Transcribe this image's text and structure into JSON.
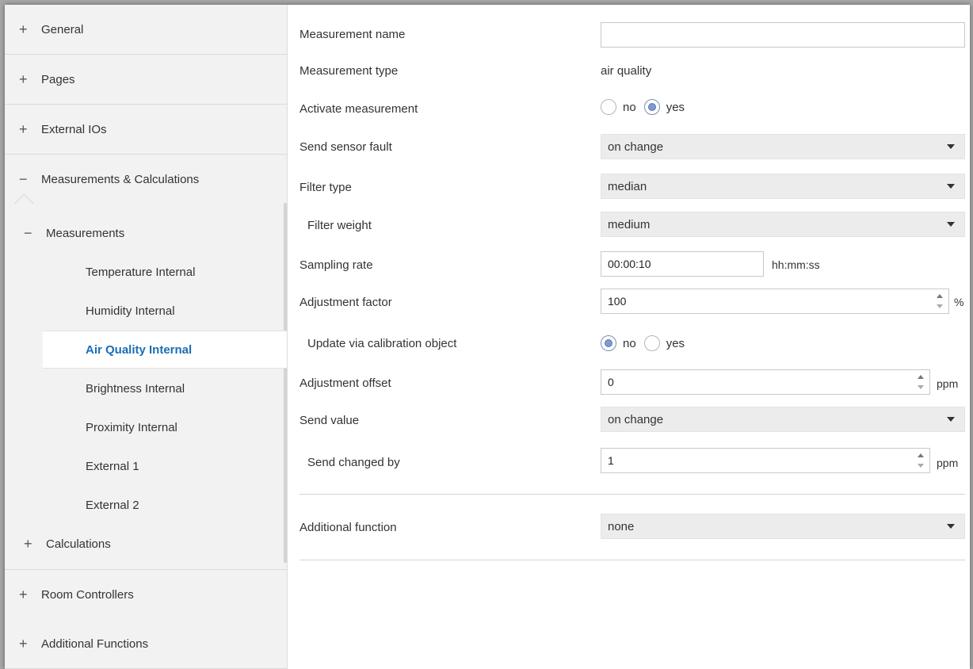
{
  "sidebar": {
    "top_items": [
      {
        "sign": "+",
        "label": "General"
      },
      {
        "sign": "+",
        "label": "Pages"
      },
      {
        "sign": "+",
        "label": "External IOs"
      },
      {
        "sign": "−",
        "label": "Measurements & Calculations"
      }
    ],
    "measurements": {
      "sign": "−",
      "label": "Measurements"
    },
    "measurement_items": [
      "Temperature Internal",
      "Humidity Internal",
      "Air Quality Internal",
      "Brightness Internal",
      "Proximity Internal",
      "External 1",
      "External 2"
    ],
    "active_item": "Air Quality Internal",
    "calculations": {
      "sign": "+",
      "label": "Calculations"
    },
    "bottom_items": [
      {
        "sign": "+",
        "label": "Room Controllers"
      },
      {
        "sign": "+",
        "label": "Additional Functions"
      }
    ]
  },
  "form": {
    "measurement_name": {
      "label": "Measurement name",
      "value": ""
    },
    "measurement_type": {
      "label": "Measurement type",
      "value": "air quality"
    },
    "activate_measurement": {
      "label": "Activate measurement",
      "options": [
        "no",
        "yes"
      ],
      "selected": "yes"
    },
    "send_sensor_fault": {
      "label": "Send sensor fault",
      "value": "on change"
    },
    "filter_type": {
      "label": "Filter type",
      "value": "median"
    },
    "filter_weight": {
      "label": "Filter weight",
      "value": "medium"
    },
    "sampling_rate": {
      "label": "Sampling rate",
      "value": "00:00:10",
      "unit": "hh:mm:ss"
    },
    "adjustment_factor": {
      "label": "Adjustment factor",
      "value": "100",
      "unit": "%"
    },
    "update_via_calibration": {
      "label": "Update via calibration object",
      "options": [
        "no",
        "yes"
      ],
      "selected": "no"
    },
    "adjustment_offset": {
      "label": "Adjustment offset",
      "value": "0",
      "unit": "ppm"
    },
    "send_value": {
      "label": "Send value",
      "value": "on change"
    },
    "send_changed_by": {
      "label": "Send changed by",
      "value": "1",
      "unit": "ppm"
    },
    "additional_function": {
      "label": "Additional function",
      "value": "none"
    }
  },
  "colors": {
    "active_item": "#1a6eb5",
    "radio_selected": "#7e9ad1"
  }
}
